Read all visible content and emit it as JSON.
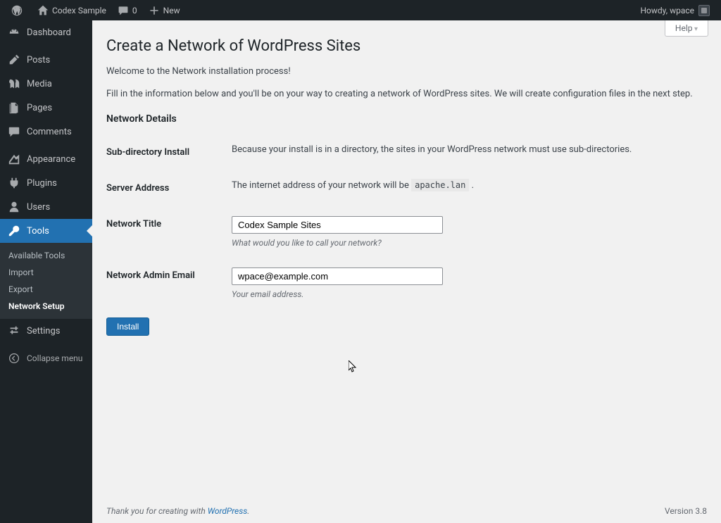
{
  "adminbar": {
    "site_name": "Codex Sample",
    "comment_count": "0",
    "new_label": "New",
    "howdy": "Howdy, wpace"
  },
  "sidebar": {
    "items": [
      {
        "label": "Dashboard",
        "icon": "dashboard"
      },
      {
        "label": "Posts",
        "icon": "posts"
      },
      {
        "label": "Media",
        "icon": "media"
      },
      {
        "label": "Pages",
        "icon": "pages"
      },
      {
        "label": "Comments",
        "icon": "comments"
      },
      {
        "label": "Appearance",
        "icon": "appearance"
      },
      {
        "label": "Plugins",
        "icon": "plugins"
      },
      {
        "label": "Users",
        "icon": "users"
      },
      {
        "label": "Tools",
        "icon": "tools",
        "current": true
      },
      {
        "label": "Settings",
        "icon": "settings"
      }
    ],
    "submenu": [
      {
        "label": "Available Tools"
      },
      {
        "label": "Import"
      },
      {
        "label": "Export"
      },
      {
        "label": "Network Setup",
        "current": true
      }
    ],
    "collapse": "Collapse menu"
  },
  "page": {
    "help": "Help",
    "title": "Create a Network of WordPress Sites",
    "intro1": "Welcome to the Network installation process!",
    "intro2": "Fill in the information below and you'll be on your way to creating a network of WordPress sites. We will create configuration files in the next step.",
    "section": "Network Details",
    "rows": {
      "subdir": {
        "th": "Sub-directory Install",
        "td": "Because your install is in a directory, the sites in your WordPress network must use sub-directories."
      },
      "server": {
        "th": "Server Address",
        "td_pre": "The internet address of your network will be ",
        "code": "apache.lan",
        "td_post": " ."
      },
      "title": {
        "th": "Network Title",
        "value": "Codex Sample Sites",
        "desc": "What would you like to call your network?"
      },
      "email": {
        "th": "Network Admin Email",
        "value": "wpace@example.com",
        "desc": "Your email address."
      }
    },
    "submit": "Install"
  },
  "footer": {
    "thanks_pre": "Thank you for creating with ",
    "wp": "WordPress",
    "thanks_post": ".",
    "version": "Version 3.8"
  }
}
